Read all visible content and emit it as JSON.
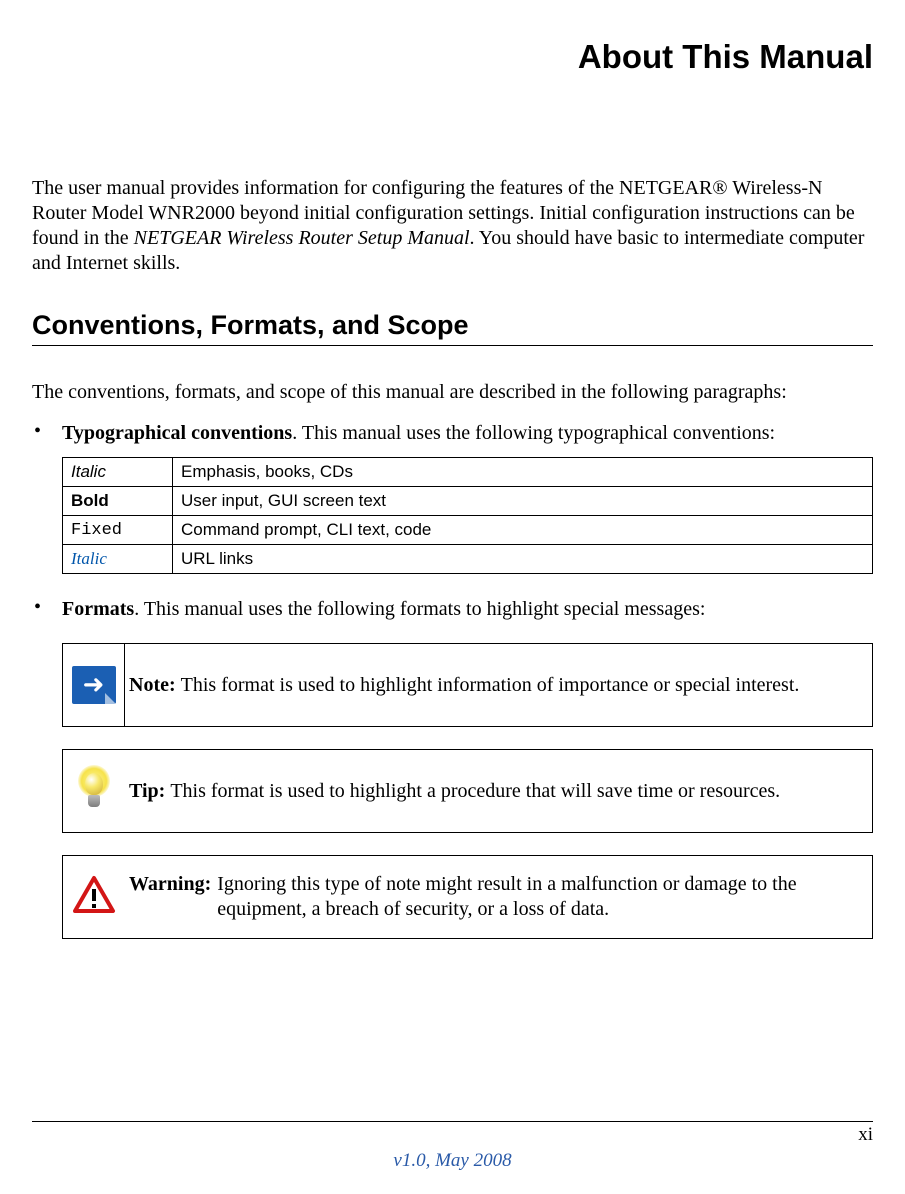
{
  "title": "About This Manual",
  "intro": {
    "part1": "The user manual provides information for configuring the features of the NETGEAR",
    "reg": "®",
    "part2": " Wireless-N Router Model WNR2000  beyond initial configuration settings. Initial configuration instructions can be found in the ",
    "italic": "NETGEAR Wireless Router Setup Manual",
    "part3": ". You should have basic to intermediate computer and Internet skills."
  },
  "section_heading": "Conventions, Formats, and Scope",
  "section_intro": "The conventions, formats, and scope of this manual are described in the following paragraphs:",
  "bullet1": {
    "label": "Typographical conventions",
    "rest": ". This manual uses the following typographical conventions:"
  },
  "conv_table": {
    "rows": [
      {
        "c1": "Italic",
        "c2": "Emphasis, books, CDs",
        "style": "it"
      },
      {
        "c1": "Bold",
        "c2": "User input, GUI screen text",
        "style": "bd"
      },
      {
        "c1": "Fixed",
        "c2": "Command prompt, CLI text, code",
        "style": "fx"
      },
      {
        "c1": "Italic",
        "c2": "URL links",
        "style": "blue-italic"
      }
    ]
  },
  "bullet2": {
    "label": "Formats",
    "rest": ". This manual uses the following formats to highlight special messages:"
  },
  "note": {
    "label": "Note: ",
    "text": "This format is used to highlight information of importance or special interest."
  },
  "tip": {
    "label": "Tip: ",
    "text": "This format is used to highlight a procedure that will save time or resources."
  },
  "warning": {
    "label": "Warning: ",
    "text": "Ignoring this type of note might result in a malfunction or damage to the equipment, a breach of security, or a loss of data."
  },
  "page_number": "xi",
  "footer_version": "v1.0, May 2008"
}
